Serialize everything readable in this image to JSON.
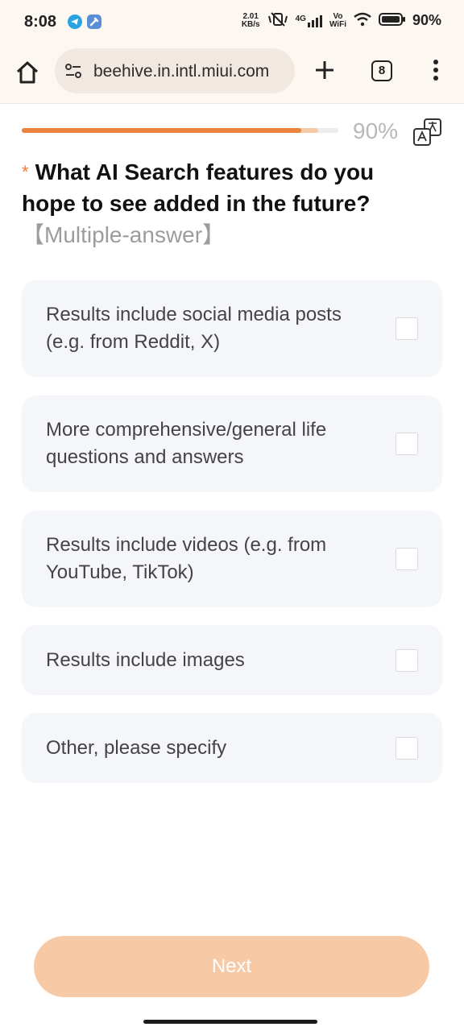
{
  "status_bar": {
    "time": "8:08",
    "speed_top": "2.01",
    "speed_bottom": "KB/s",
    "network": "4G",
    "vo_top": "Vo",
    "vo_bottom": "WiFi",
    "battery": "90%"
  },
  "browser": {
    "url": "beehive.in.intl.miui.com",
    "tab_count": "8"
  },
  "survey": {
    "progress_text": "90%",
    "progress_value": 0.9,
    "required_mark": "*",
    "question": "What AI Search features do you hope to see added in the future?",
    "answer_hint": "【Multiple-answer】",
    "options": [
      {
        "label": "Results include social media posts (e.g. from Reddit, X)",
        "checked": false
      },
      {
        "label": "More comprehensive/general life questions and answers",
        "checked": false
      },
      {
        "label": "Results include videos (e.g. from YouTube, TikTok)",
        "checked": false
      },
      {
        "label": "Results include images",
        "checked": false
      },
      {
        "label": "Other, please specify",
        "checked": false
      }
    ],
    "next_label": "Next"
  },
  "colors": {
    "accent": "#e9833e",
    "next_button": "#f7c9a5",
    "option_bg": "#f5f6fa"
  }
}
